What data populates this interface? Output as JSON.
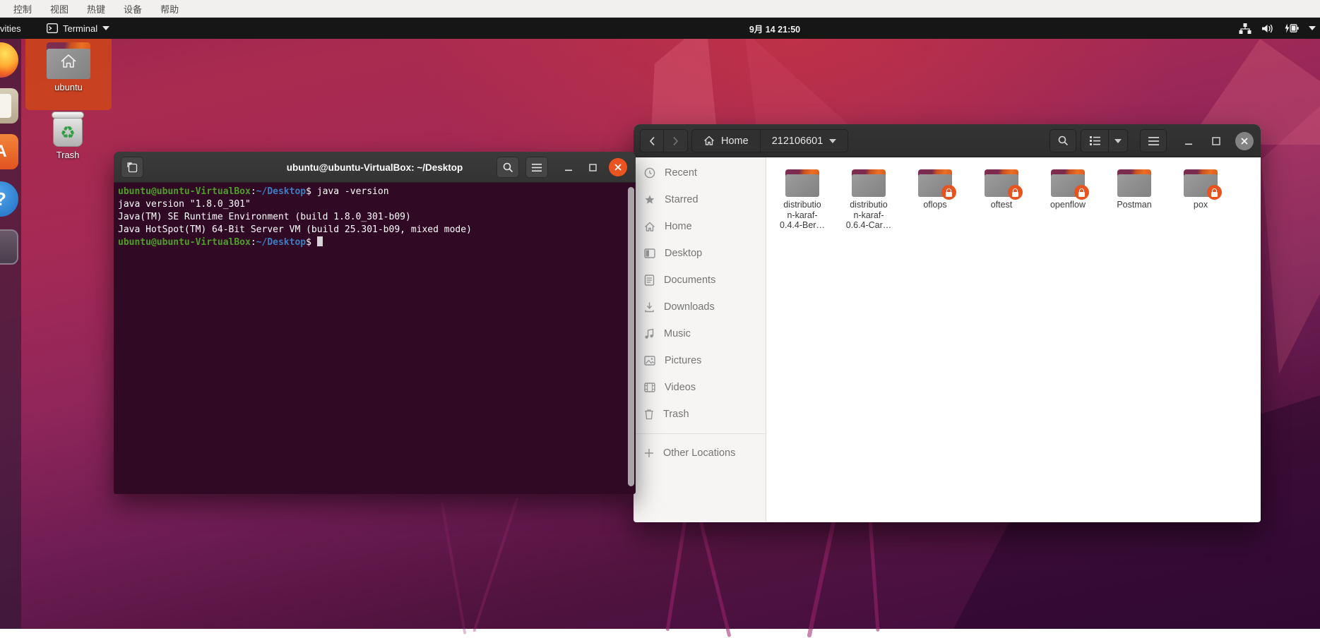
{
  "vbox_menubar": {
    "items": [
      {
        "label": "控制"
      },
      {
        "label": "视图"
      },
      {
        "label": "热键"
      },
      {
        "label": "设备"
      },
      {
        "label": "帮助"
      }
    ]
  },
  "top_bar": {
    "activities_label": "vities",
    "focused_app": "Terminal",
    "clock": "9月 14 21:50"
  },
  "dock": {
    "items": [
      {
        "name": "firefox"
      },
      {
        "name": "files"
      },
      {
        "name": "ubuntu-software",
        "glyph": "A"
      },
      {
        "name": "help",
        "glyph": "?"
      },
      {
        "name": "app-window"
      }
    ]
  },
  "desktop_icons": {
    "ubuntu": {
      "label": "ubuntu",
      "selected": true
    },
    "trash": {
      "label": "Trash",
      "glyph": "♻"
    }
  },
  "terminal": {
    "title": "ubuntu@ubuntu-VirtualBox: ~/Desktop",
    "prompt": {
      "user": "ubuntu@ubuntu-VirtualBox",
      "colon": ":",
      "path": "~/Desktop",
      "symbol": "$"
    },
    "command_display": " java -version",
    "output_lines": [
      "java version \"1.8.0_301\"",
      "Java(TM) SE Runtime Environment (build 1.8.0_301-b09)",
      "Java HotSpot(TM) 64-Bit Server VM (build 25.301-b09, mixed mode)"
    ]
  },
  "files_window": {
    "path_bar": {
      "segments": [
        {
          "label": "Home"
        },
        {
          "label": "212106601"
        }
      ]
    },
    "sidebar": {
      "items": [
        {
          "label": "Recent"
        },
        {
          "label": "Starred"
        },
        {
          "label": "Home"
        },
        {
          "label": "Desktop"
        },
        {
          "label": "Documents"
        },
        {
          "label": "Downloads"
        },
        {
          "label": "Music"
        },
        {
          "label": "Pictures"
        },
        {
          "label": "Videos"
        },
        {
          "label": "Trash"
        },
        {
          "label": "Other Locations"
        }
      ]
    },
    "folders": [
      {
        "name": "distributio\nn-karaf-\n0.4.4-Ber…",
        "locked": false
      },
      {
        "name": "distributio\nn-karaf-\n0.6.4-Car…",
        "locked": false
      },
      {
        "name": "oflops",
        "locked": true
      },
      {
        "name": "oftest",
        "locked": true
      },
      {
        "name": "openflow",
        "locked": true
      },
      {
        "name": "Postman",
        "locked": false
      },
      {
        "name": "pox",
        "locked": true
      }
    ]
  },
  "colors": {
    "ubuntu_orange": "#e95420",
    "terminal_bg": "#300a24",
    "prompt_green": "#4f9e28",
    "prompt_blue": "#3d7cc2",
    "desktop_selection": "#c9421f",
    "header_dark": "#333333"
  }
}
